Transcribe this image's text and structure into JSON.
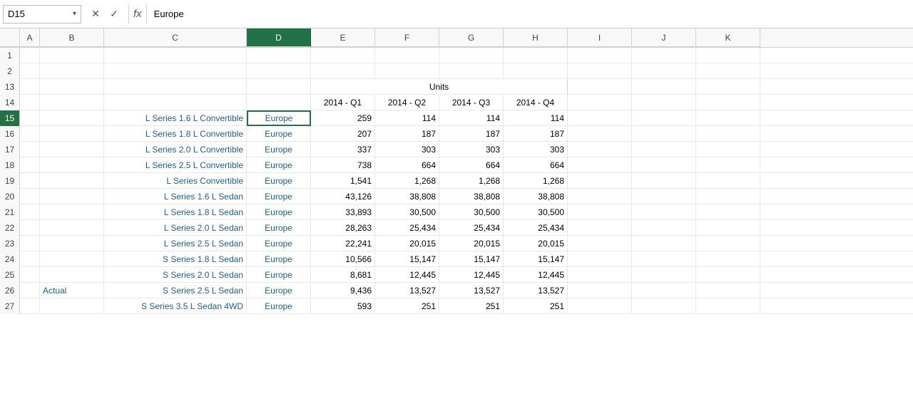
{
  "nameBox": {
    "value": "D15"
  },
  "formulaBar": {
    "value": "Europe"
  },
  "columns": [
    "A",
    "B",
    "C",
    "D",
    "E",
    "F",
    "G",
    "H",
    "I",
    "J",
    "K"
  ],
  "activeCell": "D15",
  "rows": [
    {
      "num": 1,
      "cells": [
        "",
        "",
        "",
        "",
        "",
        "",
        "",
        "",
        "",
        "",
        ""
      ]
    },
    {
      "num": 2,
      "cells": [
        "",
        "",
        "",
        "",
        "",
        "",
        "",
        "",
        "",
        "",
        ""
      ]
    },
    {
      "num": 13,
      "cells": [
        "",
        "",
        "",
        "",
        "",
        "Units",
        "",
        "",
        "",
        "",
        ""
      ]
    },
    {
      "num": 14,
      "cells": [
        "",
        "",
        "",
        "",
        "2014 - Q1",
        "2014 - Q2",
        "2014 - Q3",
        "2014 - Q4",
        "",
        "",
        ""
      ]
    },
    {
      "num": 15,
      "cells": [
        "",
        "",
        "L Series 1.6 L Convertible",
        "Europe",
        "259",
        "114",
        "114",
        "114",
        "",
        "",
        ""
      ]
    },
    {
      "num": 16,
      "cells": [
        "",
        "",
        "L Series 1.8 L Convertible",
        "Europe",
        "207",
        "187",
        "187",
        "187",
        "",
        "",
        ""
      ]
    },
    {
      "num": 17,
      "cells": [
        "",
        "",
        "L Series 2.0 L Convertible",
        "Europe",
        "337",
        "303",
        "303",
        "303",
        "",
        "",
        ""
      ]
    },
    {
      "num": 18,
      "cells": [
        "",
        "",
        "L Series 2.5 L Convertible",
        "Europe",
        "738",
        "664",
        "664",
        "664",
        "",
        "",
        ""
      ]
    },
    {
      "num": 19,
      "cells": [
        "",
        "",
        "L Series Convertible",
        "Europe",
        "1,541",
        "1,268",
        "1,268",
        "1,268",
        "",
        "",
        ""
      ]
    },
    {
      "num": 20,
      "cells": [
        "",
        "",
        "L Series 1.6 L Sedan",
        "Europe",
        "43,126",
        "38,808",
        "38,808",
        "38,808",
        "",
        "",
        ""
      ]
    },
    {
      "num": 21,
      "cells": [
        "",
        "",
        "L Series 1.8 L Sedan",
        "Europe",
        "33,893",
        "30,500",
        "30,500",
        "30,500",
        "",
        "",
        ""
      ]
    },
    {
      "num": 22,
      "cells": [
        "",
        "",
        "L Series 2.0 L Sedan",
        "Europe",
        "28,263",
        "25,434",
        "25,434",
        "25,434",
        "",
        "",
        ""
      ]
    },
    {
      "num": 23,
      "cells": [
        "",
        "",
        "L Series 2.5 L Sedan",
        "Europe",
        "22,241",
        "20,015",
        "20,015",
        "20,015",
        "",
        "",
        ""
      ]
    },
    {
      "num": 24,
      "cells": [
        "",
        "",
        "S Series 1.8 L Sedan",
        "Europe",
        "10,566",
        "15,147",
        "15,147",
        "15,147",
        "",
        "",
        ""
      ]
    },
    {
      "num": 25,
      "cells": [
        "",
        "",
        "S Series 2.0 L Sedan",
        "Europe",
        "8,681",
        "12,445",
        "12,445",
        "12,445",
        "",
        "",
        ""
      ]
    },
    {
      "num": 26,
      "cells": [
        "",
        "Actual",
        "S Series 2.5 L Sedan",
        "Europe",
        "9,436",
        "13,527",
        "13,527",
        "13,527",
        "",
        "",
        ""
      ]
    },
    {
      "num": 27,
      "cells": [
        "",
        "",
        "S Series 3.5 L Sedan 4WD",
        "Europe",
        "593",
        "251",
        "251",
        "251",
        "",
        "",
        ""
      ]
    }
  ]
}
